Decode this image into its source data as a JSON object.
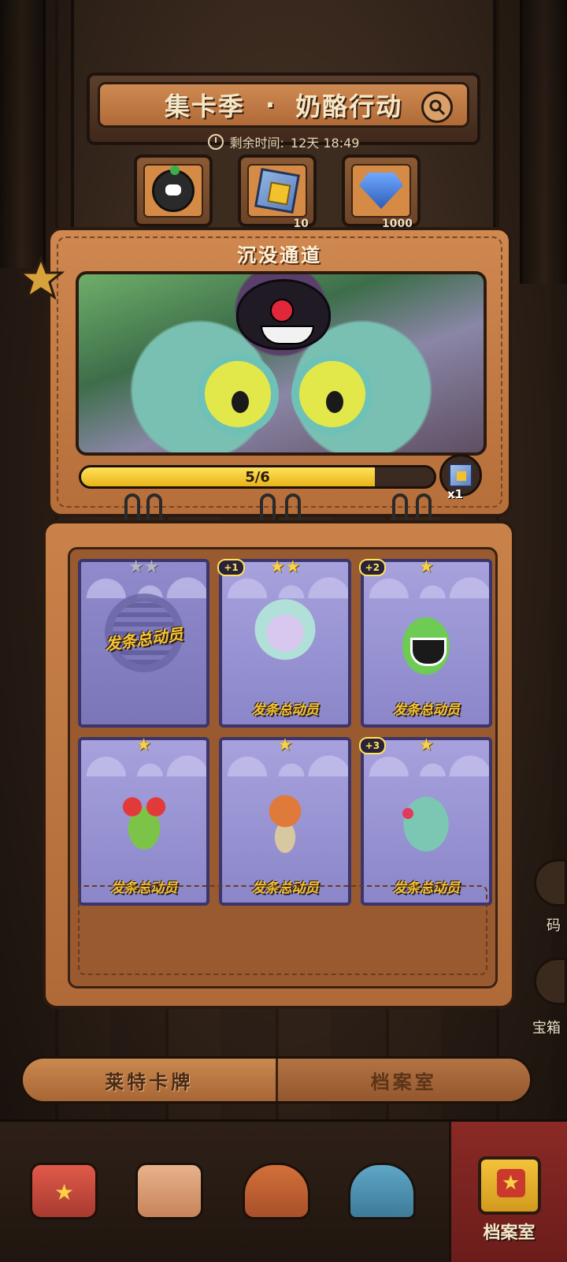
{
  "header": {
    "title_left": "集卡季",
    "title_sep": "·",
    "title_right": "奶酪行动",
    "timer_label": "剩余时间:",
    "timer_value": "12天 18:49"
  },
  "resources": [
    {
      "icon": "avatar-icon",
      "count": ""
    },
    {
      "icon": "cube-icon",
      "count": "10"
    },
    {
      "icon": "gem-icon",
      "count": "1000"
    }
  ],
  "chapter": {
    "title": "沉没通道",
    "progress_text": "5/6",
    "progress_fraction": 0.833,
    "reward_count": "x1"
  },
  "cards": [
    {
      "name": "发条总动员",
      "stars": 2,
      "owned": false,
      "dup": ""
    },
    {
      "name": "发条总动员",
      "stars": 2,
      "owned": true,
      "dup": "+1"
    },
    {
      "name": "发条总动员",
      "stars": 1,
      "owned": true,
      "dup": "+2"
    },
    {
      "name": "发条总动员",
      "stars": 1,
      "owned": true,
      "dup": ""
    },
    {
      "name": "发条总动员",
      "stars": 1,
      "owned": true,
      "dup": ""
    },
    {
      "name": "发条总动员",
      "stars": 1,
      "owned": true,
      "dup": "+3"
    }
  ],
  "side": {
    "item1_label": "码",
    "item2_label": "宝箱"
  },
  "tabs": [
    {
      "label": "莱特卡牌",
      "active": true
    },
    {
      "label": "档案室",
      "active": false
    }
  ],
  "nav": {
    "archive_label": "档案室"
  },
  "colors": {
    "progress_fill": "#e8b418",
    "star": "#f8d246",
    "card_bg": "#a7a2dd",
    "wood": "#b66e3a"
  }
}
